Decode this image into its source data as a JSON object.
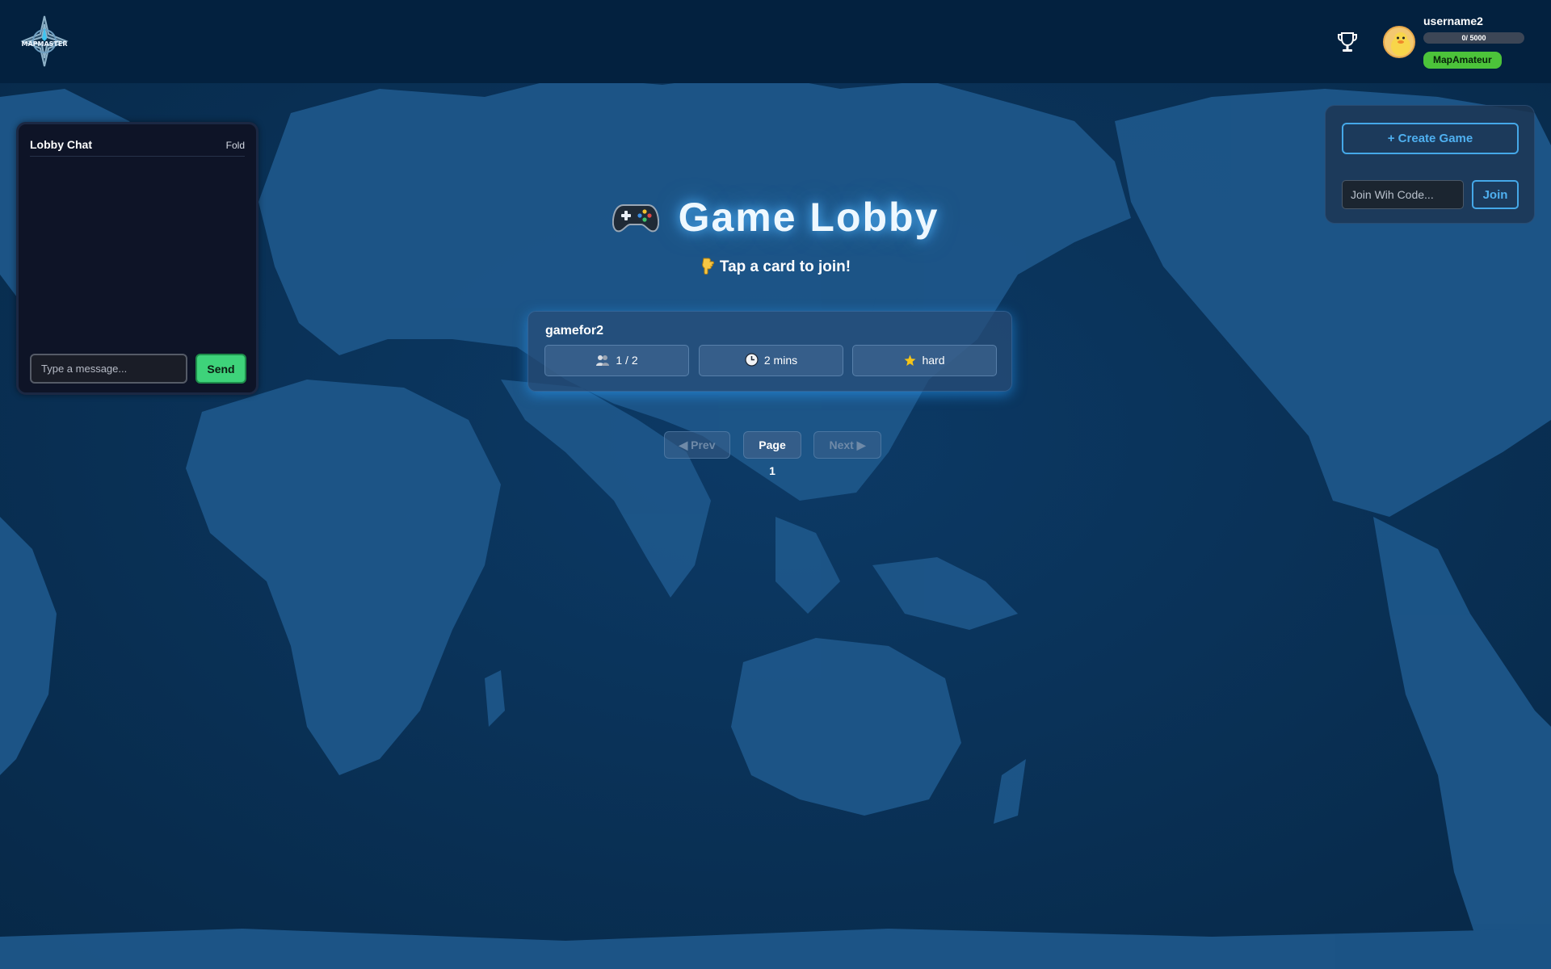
{
  "header": {
    "logo_text": "MAPMASTER",
    "trophy_icon": "trophy-icon",
    "user": {
      "username": "username2",
      "xp_text": "0/ 5000",
      "xp_progress": 0,
      "rank": "MapAmateur"
    }
  },
  "chat": {
    "title": "Lobby Chat",
    "fold_label": "Fold",
    "input_placeholder": "Type a message...",
    "send_label": "Send",
    "messages": []
  },
  "lobby": {
    "icon": "gamepad-icon",
    "title": "Game Lobby",
    "subtitle": "Tap a card to join!",
    "subtitle_icon": "pointing-hand-icon",
    "games": [
      {
        "name": "gamefor2",
        "players": "1 / 2",
        "time": "2 mins",
        "difficulty": "hard"
      }
    ],
    "pagination": {
      "prev_label": "◀ Prev",
      "page_label": "Page 1",
      "next_label": "Next ▶"
    }
  },
  "side_panel": {
    "create_label": "+ Create Game",
    "code_placeholder": "Join Wih Code...",
    "join_label": "Join"
  },
  "colors": {
    "header_bg": "#03213f",
    "ocean": "#0b3158",
    "land": "#1d5689",
    "accent": "#45a8e8",
    "send_green": "#3ed37a",
    "rank_green": "#4cc33a"
  }
}
